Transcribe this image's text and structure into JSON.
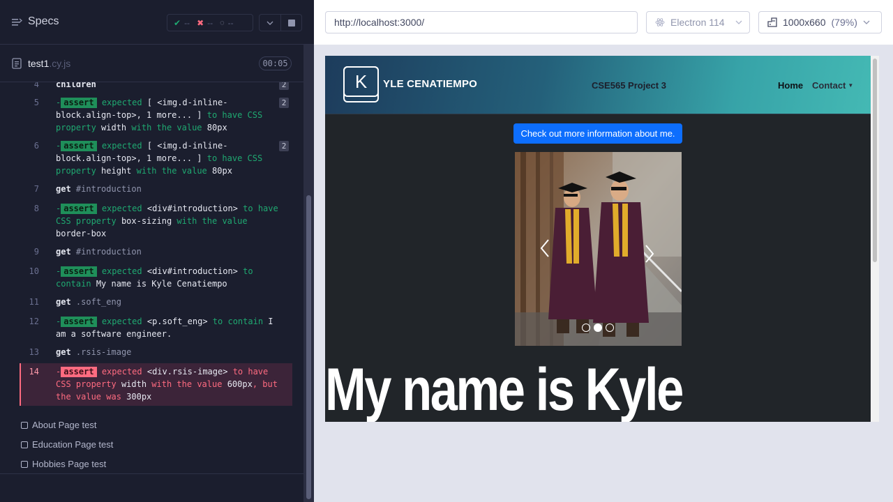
{
  "reporter": {
    "title": "Specs",
    "stats": {
      "passed": "--",
      "failed": "--",
      "pending": "--"
    },
    "spec_file": {
      "name": "test1",
      "ext": ".cy.js",
      "duration": "00:05"
    },
    "commands": [
      {
        "n": "4",
        "name": "children",
        "badge": "2"
      },
      {
        "n": "5",
        "pill": "assert",
        "badge": "2",
        "text_parts": [
          "expected",
          "[ <img.d-inline-block.align-top>, 1 more... ]",
          "to have CSS property",
          "width",
          "with the value",
          "80px"
        ]
      },
      {
        "n": "6",
        "pill": "assert",
        "badge": "2",
        "text_parts": [
          "expected",
          "[ <img.d-inline-block.align-top>, 1 more... ]",
          "to have CSS property",
          "height",
          "with the value",
          "80px"
        ]
      },
      {
        "n": "7",
        "name": "get",
        "selector": "#introduction"
      },
      {
        "n": "8",
        "pill": "assert",
        "text_parts": [
          "expected",
          "<div#introduction>",
          "to have CSS property",
          "box-sizing",
          "with the value",
          "border-box"
        ]
      },
      {
        "n": "9",
        "name": "get",
        "selector": "#introduction"
      },
      {
        "n": "10",
        "pill": "assert",
        "text_parts": [
          "expected",
          "<div#introduction>",
          "to contain",
          "My name is Kyle Cenatiempo"
        ]
      },
      {
        "n": "11",
        "name": "get",
        "selector": ".soft_eng"
      },
      {
        "n": "12",
        "pill": "assert",
        "text_parts": [
          "expected",
          "<p.soft_eng>",
          "to contain",
          "I am a software engineer."
        ]
      },
      {
        "n": "13",
        "name": "get",
        "selector": ".rsis-image"
      },
      {
        "n": "14",
        "pill": "assert",
        "failed": true,
        "text_parts": [
          "expected",
          "<div.rsis-image>",
          "to have CSS property",
          "width",
          "with the value",
          "600px",
          ", but the value was",
          "300px"
        ]
      }
    ],
    "tests": [
      "About Page test",
      "Education Page test",
      "Hobbies Page test"
    ]
  },
  "browser": {
    "url": "http://localhost:3000/",
    "name": "Electron 114",
    "viewport": "1000x660",
    "scale": "(79%)"
  },
  "site": {
    "logo_letter": "K",
    "brand": "YLE CENATIEMPO",
    "project": "CSE565 Project 3",
    "nav": {
      "home": "Home",
      "contact": "Contact"
    },
    "info_button": "Check out more information about me.",
    "headline": "My name is Kyle",
    "carousel": {
      "slides": 3,
      "active": 2
    }
  },
  "colors": {
    "pass": "#1fa971",
    "fail": "#ff6b80",
    "accent": "#0d6efd"
  }
}
